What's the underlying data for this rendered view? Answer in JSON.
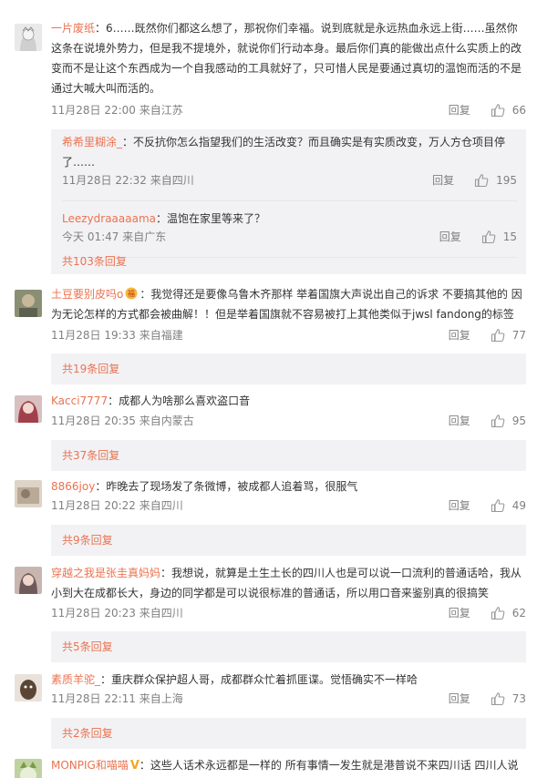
{
  "comments": [
    {
      "user": "一片废纸",
      "text": "：6……既然你们都这么想了，那祝你们幸福。说到底就是永远热血永远上街……虽然你这条在说境外势力，但是我不提境外，就说你们行动本身。最后你们真的能做出点什么实质上的改变而不是让这个东西成为一个自我感动的工具就好了，只可惜人民是要通过真切的温饱而活的不是通过大喊大叫而活的。",
      "time": "11月28日 22:00 来自江苏",
      "reply_label": "回复",
      "likes": "66",
      "avatar_color": "#cfcfcf",
      "replies": [
        {
          "user": "希希里糊涂_",
          "text": "：不反抗你怎么指望我们的生活改变？而且确实是有实质改变，万人方仓项目停了……",
          "time": "11月28日 22:32 来自四川",
          "reply_label": "回复",
          "likes": "195"
        },
        {
          "user": "Leezydraaaaama",
          "text": "：温饱在家里等来了？",
          "time": "今天 01:47 来自广东",
          "reply_label": "回复",
          "likes": "15"
        }
      ],
      "more": "共103条回复"
    },
    {
      "user": "土豆要别皮吗o",
      "text": "：我觉得还是要像乌鲁木齐那样 举着国旗大声说出自己的诉求 不要搞其他的 因为无论怎样的方式都会被曲解！！但是举着国旗就不容易被打上其他类似于jwsl fandong的标签",
      "time": "11月28日 19:33 来自福建",
      "reply_label": "回复",
      "likes": "77",
      "avatar_color": "#7a7f69",
      "more": "共19条回复"
    },
    {
      "user": "Kacci7777",
      "text": "：成都人为啥那么喜欢盗口音",
      "time": "11月28日 20:35 来自内蒙古",
      "reply_label": "回复",
      "likes": "95",
      "avatar_color": "#b06066",
      "more": "共37条回复"
    },
    {
      "user": "8866joy",
      "text": "：昨晚去了现场发了条微博，被成都人追着骂，很服气",
      "time": "11月28日 20:22 来自四川",
      "reply_label": "回复",
      "likes": "49",
      "avatar_color": "#b9aa98",
      "more": "共9条回复"
    },
    {
      "user": "穿越之我是张圭真妈妈",
      "text": "：我想说，就算是土生土长的四川人也是可以说一口流利的普通话哈，我从小到大在成都长大，身边的同学都是可以说很标准的普通话，所以用口音来鉴别真的很搞笑",
      "time": "11月28日 20:23 来自四川",
      "reply_label": "回复",
      "likes": "62",
      "avatar_color": "#8f7777",
      "more": "共5条回复"
    },
    {
      "user": "素质羊驼_",
      "text": "：重庆群众保护超人哥，成都群众忙着抓匪谍。觉悟确实不一样哈",
      "time": "11月28日 22:11 来自上海",
      "reply_label": "回复",
      "likes": "73",
      "avatar_color": "#6b5a4a",
      "more": "共2条回复"
    },
    {
      "user": "MONPIG和喵喵",
      "text": "：这些人话术永远都是一样的 所有事情一发生就是港普说不来四川话 四川人说",
      "avatar_color": "#c0d2a0"
    }
  ]
}
